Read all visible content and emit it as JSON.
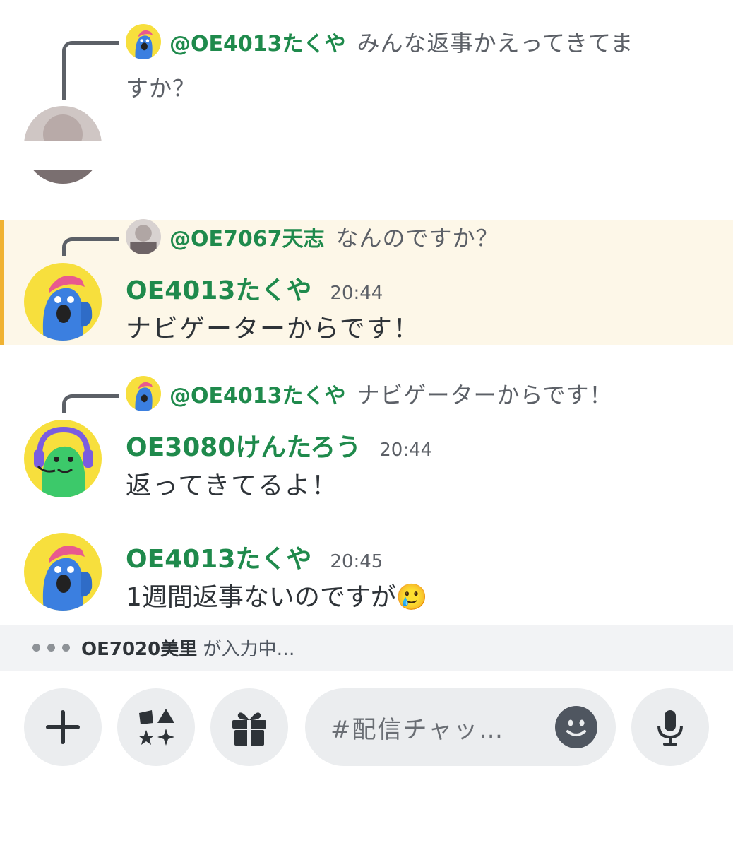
{
  "messages": [
    {
      "reply": {
        "mention": "@OE4013たくや",
        "text_line1": "みんな返事かえってきてま",
        "text_line2": "すか？"
      },
      "author": "",
      "time": "",
      "text": ""
    },
    {
      "reply": {
        "mention": "@OE7067天志",
        "text": "なんのですか？"
      },
      "author": "OE4013たくや",
      "time": "20:44",
      "text": "ナビゲーターからです！"
    },
    {
      "reply": {
        "mention": "@OE4013たくや",
        "text": "ナビゲーターからです！"
      },
      "author": "OE3080けんたろう",
      "time": "20:44",
      "text": "返ってきてるよ！"
    },
    {
      "author": "OE4013たくや",
      "time": "20:45",
      "text": "1週間返事ないのですが",
      "emoji": "🥲"
    }
  ],
  "typing": {
    "user": "OE7020美里",
    "suffix": " が入力中…"
  },
  "composer": {
    "input_placeholder": "#配信チャッ…",
    "buttons": [
      "plus-icon",
      "apps-icon",
      "gift-icon",
      "emoji-icon",
      "microphone-icon"
    ]
  },
  "colors": {
    "author": "#1f8a4c",
    "highlight": "#fdf7e8",
    "highlight_border": "#f0b232"
  }
}
